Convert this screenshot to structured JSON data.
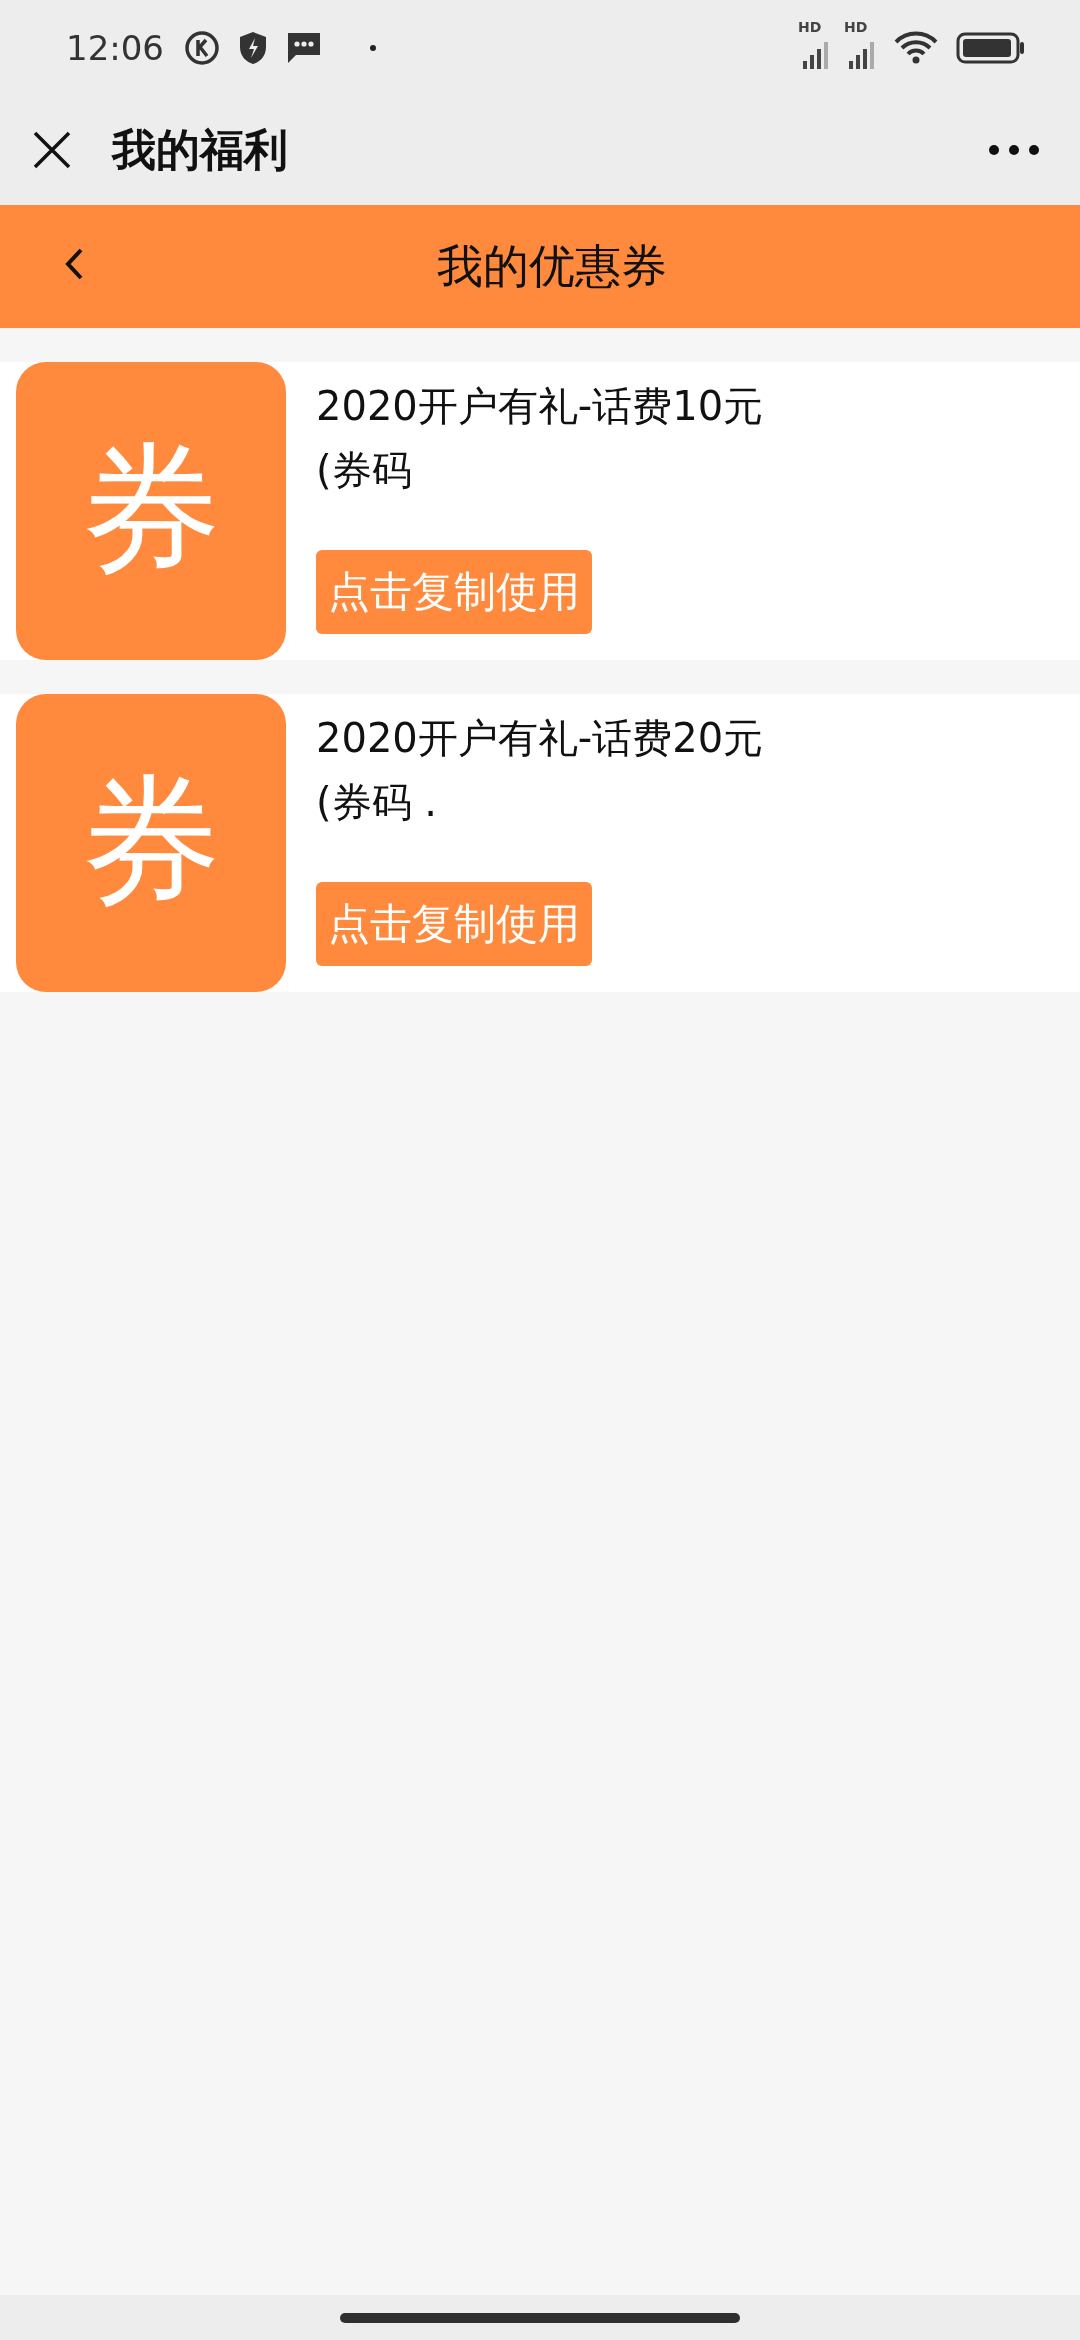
{
  "status_bar": {
    "time": "12:06",
    "signal_labels": [
      "HD",
      "HD"
    ]
  },
  "nav_bar": {
    "title": "我的福利"
  },
  "header": {
    "title": "我的优惠券"
  },
  "coupons": [
    {
      "badge": "券",
      "title": "2020开户有礼-话费10元",
      "code": "(券码",
      "button": "点击复制使用"
    },
    {
      "badge": "券",
      "title": "2020开户有礼-话费20元",
      "code": "(券码 .",
      "button": "点击复制使用"
    }
  ]
}
